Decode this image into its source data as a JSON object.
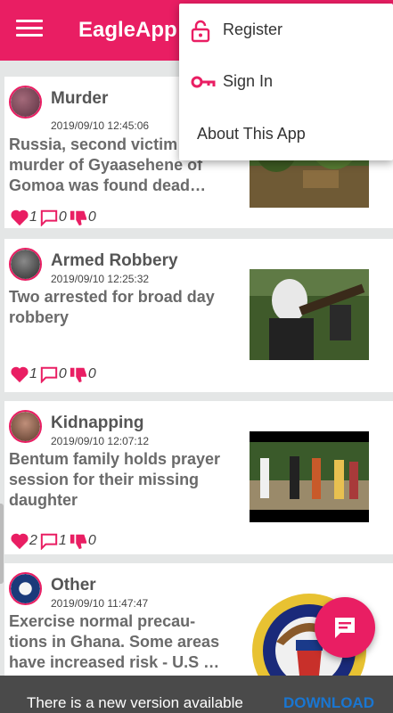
{
  "app": {
    "title": "EagleApp"
  },
  "menu": {
    "items": [
      {
        "label": "Register",
        "icon": "lock-icon"
      },
      {
        "label": "Sign In",
        "icon": "key-icon"
      },
      {
        "label": "About This App"
      }
    ]
  },
  "posts": [
    {
      "category": "Murder",
      "timestamp": "2019/09/10 12:45:06",
      "headline": "Russia, second victim in the murder of Gyaasehene of Gomoa was found dead…",
      "likes": "1",
      "comments": "0",
      "dislikes": "0"
    },
    {
      "category": "Armed Robbery",
      "timestamp": "2019/09/10 12:25:32",
      "headline": "Two arrested for broad day robbery",
      "likes": "1",
      "comments": "0",
      "dislikes": "0"
    },
    {
      "category": "Kidnapping",
      "timestamp": "2019/09/10 12:07:12",
      "headline": "Bentum family holds prayer session for their missing daughter",
      "likes": "2",
      "comments": "1",
      "dislikes": "0"
    },
    {
      "category": "Other",
      "timestamp": "2019/09/10 11:47:47",
      "headline": "Exercise normal precau-tions in Ghana. Some areas have increased risk - U.S …",
      "likes": "",
      "comments": "",
      "dislikes": ""
    }
  ],
  "snackbar": {
    "message": "There is a new version available",
    "action": "DOWNLOAD"
  },
  "colors": {
    "primary": "#e91e63",
    "action": "#1976d2"
  }
}
